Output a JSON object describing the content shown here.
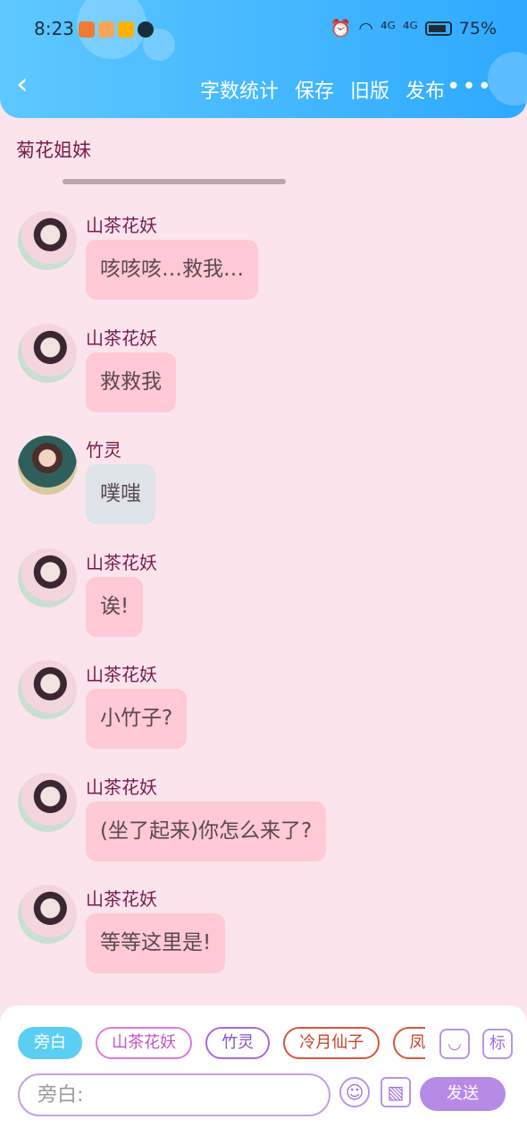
{
  "status_bar": {
    "time": "8:23",
    "battery": "75%",
    "signal_1": "⁴ᴳ",
    "signal_2": "⁴ᴳ"
  },
  "nav": {
    "word_count": "字数统计",
    "save": "保存",
    "old_version": "旧版",
    "publish": "发布",
    "more": "•••"
  },
  "page_title": "菊花姐妹",
  "messages": [
    {
      "name": "山茶花妖",
      "text": "咳咳咳…救我…"
    },
    {
      "name": "山茶花妖",
      "text": "救救我"
    },
    {
      "name": "竹灵",
      "text": "噗嗤"
    },
    {
      "name": "山茶花妖",
      "text": "诶!"
    },
    {
      "name": "山茶花妖",
      "text": "小竹子?"
    },
    {
      "name": "山茶花妖",
      "text": "(坐了起来)你怎么来了?"
    },
    {
      "name": "山茶花妖",
      "text": "等等这里是!"
    }
  ],
  "bottom": {
    "chips": [
      "旁白",
      "山茶花妖",
      "竹灵",
      "冷月仙子",
      "凤兰"
    ],
    "input_placeholder": "旁白:",
    "send": "发送",
    "tag_button": "标"
  },
  "colors": {
    "header": "#2ea9ff",
    "background": "#fbe4ec",
    "bubble_pink": "#ffc9d6",
    "bubble_gray": "#dfe3ea",
    "accent_purple": "#b78ae6"
  }
}
